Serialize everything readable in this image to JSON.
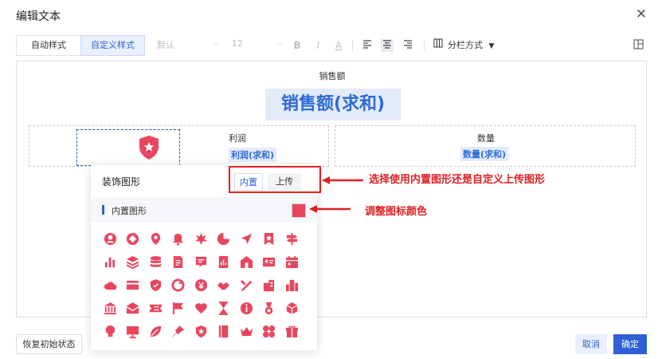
{
  "dialog": {
    "title": "编辑文本"
  },
  "toolbar": {
    "auto_style": "自动样式",
    "custom_style": "自定义样式",
    "font": "默认",
    "font_size": "12",
    "split": "分栏方式"
  },
  "editor": {
    "sales_label": "销售额",
    "sales_field": "销售额(求和)",
    "profit_label": "利润",
    "profit_field": "利润(求和)",
    "quantity_label": "数量",
    "quantity_field": "数量(求和)"
  },
  "popup": {
    "title": "装饰图形",
    "tab_builtin": "内置",
    "tab_upload": "上传",
    "section_label": "内置图形",
    "icon_color": "#e8465f",
    "icons": [
      "user-icon",
      "diamond-icon",
      "location-pin-icon",
      "bell-icon",
      "star-burst-icon",
      "pie-chart-icon",
      "navigate-icon",
      "bookmark-star-icon",
      "signpost-icon",
      "bar-chart-icon",
      "layers-icon",
      "database-icon",
      "document-icon",
      "message-box-icon",
      "chart-doc-icon",
      "house-icon",
      "id-card-icon",
      "calendar-icon",
      "cloud-icon",
      "credit-card-icon",
      "shield-check-icon",
      "refresh-icon",
      "yen-coin-icon",
      "handshake-icon",
      "pencil-ruler-icon",
      "building-icon",
      "city-icon",
      "bank-icon",
      "mail-icon",
      "ticket-icon",
      "flag-icon",
      "heart-icon",
      "hourglass-icon",
      "info-icon",
      "medal-icon",
      "cube-icon",
      "lightbulb-icon",
      "presentation-icon",
      "leaf-icon",
      "pin-icon",
      "shield-star-icon",
      "book-icon",
      "crown-icon",
      "clover-icon",
      "gift-icon"
    ]
  },
  "annotations": {
    "choose_source": "选择使用内置图形还是自定义上传图形",
    "adjust_color": "调整图标颜色"
  },
  "footer": {
    "restore": "恢复初始状态",
    "cancel": "取消",
    "ok": "确定"
  }
}
